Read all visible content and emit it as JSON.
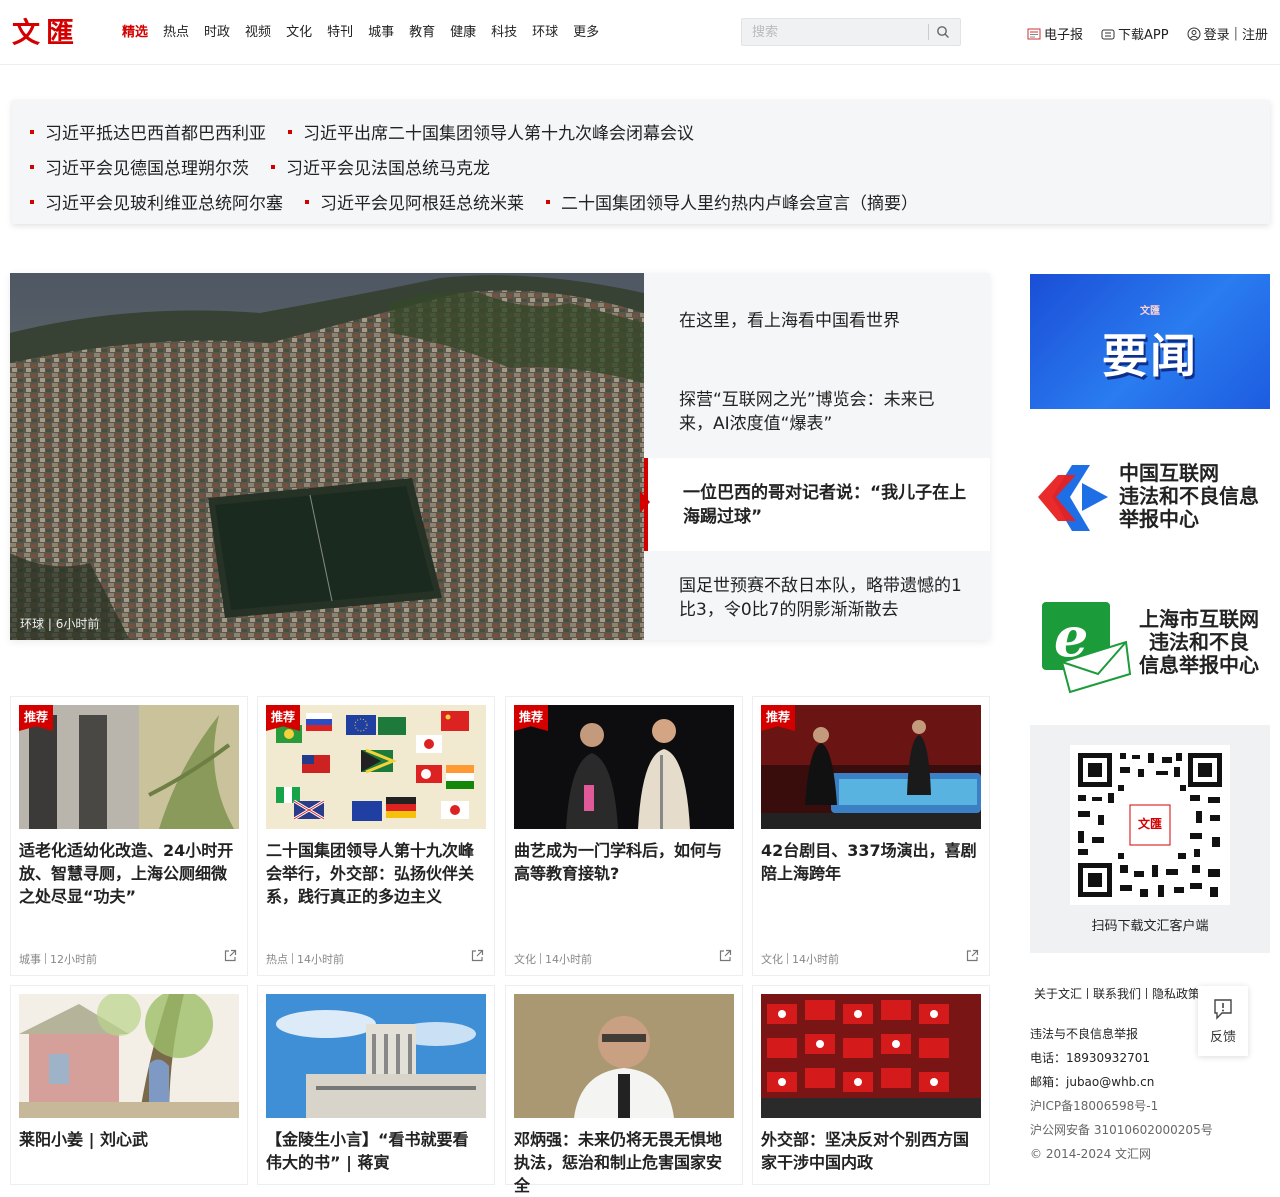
{
  "logo": "文匯",
  "nav": [
    "精选",
    "热点",
    "时政",
    "视频",
    "文化",
    "特刊",
    "城事",
    "教育",
    "健康",
    "科技",
    "环球",
    "更多"
  ],
  "search": {
    "placeholder": "搜索"
  },
  "header_links": {
    "epaper": "电子报",
    "app": "下载APP",
    "login": "登录",
    "register": "注册"
  },
  "headlines": [
    [
      "习近平抵达巴西首都巴西利亚",
      "习近平出席二十国集团领导人第十九次峰会闭幕会议"
    ],
    [
      "习近平会见德国总理朔尔茨",
      "习近平会见法国总统马克龙"
    ],
    [
      "习近平会见玻利维亚总统阿尔塞",
      "习近平会见阿根廷总统米莱",
      "二十国集团领导人里约热内卢峰会宣言（摘要）"
    ]
  ],
  "feature": {
    "caption_tag": "环球",
    "caption_time": "6小时前",
    "items": [
      "在这里，看上海看中国看世界",
      "探营“互联网之光”博览会：未来已来，AI浓度值“爆表”",
      "一位巴西的哥对记者说：“我儿子在上海踢过球”",
      "国足世预赛不敌日本队，略带遗憾的1比3，令0比7的阴影渐渐散去"
    ]
  },
  "cards": [
    {
      "badge": "推荐",
      "title": "适老化适幼化改造、24小时开放、智慧寻厕，上海公厕细微之处尽显“功夫”",
      "tag": "城事",
      "time": "12小时前"
    },
    {
      "badge": "推荐",
      "title": "二十国集团领导人第十九次峰会举行，外交部：弘扬伙伴关系，践行真正的多边主义",
      "tag": "热点",
      "time": "14小时前"
    },
    {
      "badge": "推荐",
      "title": "曲艺成为一门学科后，如何与高等教育接轨?",
      "tag": "文化",
      "time": "14小时前"
    },
    {
      "badge": "推荐",
      "title": "42台剧目、337场演出，喜剧陪上海跨年",
      "tag": "文化",
      "time": "14小时前"
    },
    {
      "badge": "",
      "title": "莱阳小姜 | 刘心武",
      "tag": "",
      "time": ""
    },
    {
      "badge": "",
      "title": "【金陵生小言】“看书就要看伟大的书” | 蒋寅",
      "tag": "",
      "time": ""
    },
    {
      "badge": "",
      "title": "邓炳强：未来仍将无畏无惧地执法，惩治和制止危害国家安全",
      "tag": "",
      "time": ""
    },
    {
      "badge": "",
      "title": "外交部：坚决反对个别西方国家干涉中国内政",
      "tag": "",
      "time": ""
    }
  ],
  "sidebar": {
    "banner_small": "文匯",
    "banner_big": "要闻",
    "report1": [
      "中国互联网",
      "违法和不良信息",
      "举报中心"
    ],
    "report2": [
      "上海市互联网",
      "违法和不良",
      "信息举报中心"
    ],
    "qr_caption": "扫码下载文汇客户端",
    "qr_center": "文匯",
    "footer_links": [
      "关于文汇",
      "联系我们",
      "隐私政策"
    ],
    "report_line": "违法与不良信息举报",
    "phone": "电话：18930932701",
    "email": "邮箱：jubao@whb.cn",
    "icp": "沪ICP备18006598号-1",
    "police": "沪公网安备 31010602000205号",
    "copyright": "© 2014-2024 文汇网",
    "feedback": "反馈"
  },
  "colors": {
    "brand_red": "#d40000",
    "nav_text": "#222222"
  }
}
